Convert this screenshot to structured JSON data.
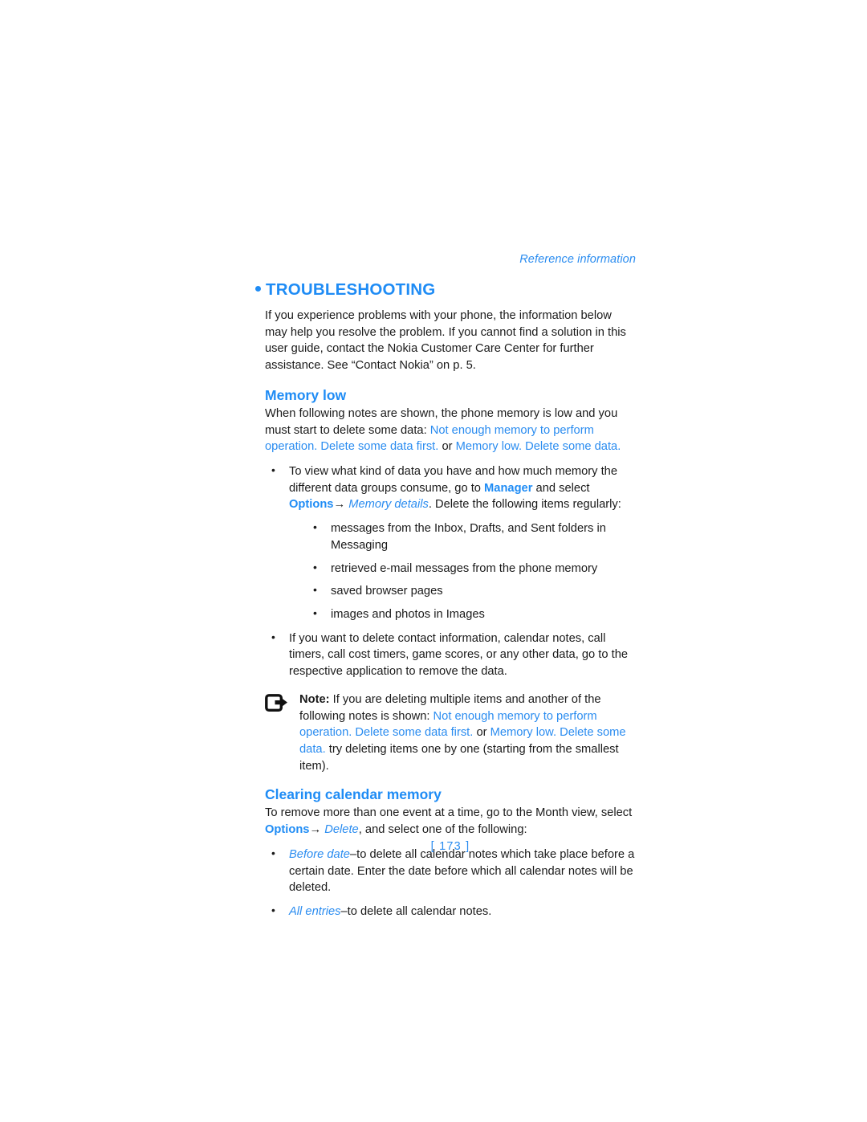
{
  "running_header": "Reference information",
  "chapter": {
    "title": "TROUBLESHOOTING",
    "intro": "If you experience problems with your phone, the information below may help you resolve the problem. If you cannot find a solution in this user guide, contact the Nokia Customer Care Center for further assistance. See “Contact Nokia” on p. 5."
  },
  "memory_low": {
    "heading": "Memory low",
    "intro_before": "When following notes are shown, the phone memory is low and you must start to delete some data: ",
    "message_1": "Not enough memory to perform operation. Delete some data first.",
    "intro_join": " or ",
    "message_2": "Memory low. Delete some data.",
    "bullet_1": {
      "text_before": "To view what kind of data you have and how much memory the different data groups consume, go to ",
      "kw_manager": "Manager",
      "text_mid": " and select ",
      "kw_options": "Options",
      "arrow": "→",
      "param_memory_details": "Memory details",
      "text_after": ". Delete the following items regularly:"
    },
    "sub_bullets": [
      "messages from the Inbox, Drafts, and Sent folders in Messaging",
      "retrieved e-mail messages from the phone memory",
      "saved browser pages",
      "images and photos in Images"
    ],
    "bullet_2": "If you want to delete contact information, calendar notes, call timers, call cost timers, game scores, or any other data, go to the respective application to remove the data."
  },
  "note": {
    "icon": "note-arrow-icon",
    "label": "Note:",
    "text_before": " If you are deleting multiple items and another of the following notes is shown: ",
    "message_1": "Not enough memory to perform operation. Delete some data first.",
    "join": " or ",
    "message_2": "Memory low. Delete some data.",
    "text_after": " try deleting items one by one (starting from the smallest item)."
  },
  "clearing_calendar": {
    "heading": "Clearing calendar memory",
    "intro_before": "To remove more than one event at a time, go to the Month view, select ",
    "kw_options": "Options",
    "arrow": "→",
    "param_delete": "Delete",
    "intro_after": ", and select one of the following:",
    "bullets": [
      {
        "param": "Before date",
        "dash": "–",
        "text": "to delete all calendar notes which take place before a certain date. Enter the date before which all calendar notes will be deleted."
      },
      {
        "param": "All entries",
        "dash": "–",
        "text": "to delete all calendar notes."
      }
    ]
  },
  "page_number": "[ 173 ]",
  "colors": {
    "accent_blue": "#1f8cf5",
    "message_blue": "#2a8cf0",
    "body_text": "#1a1a1a"
  }
}
